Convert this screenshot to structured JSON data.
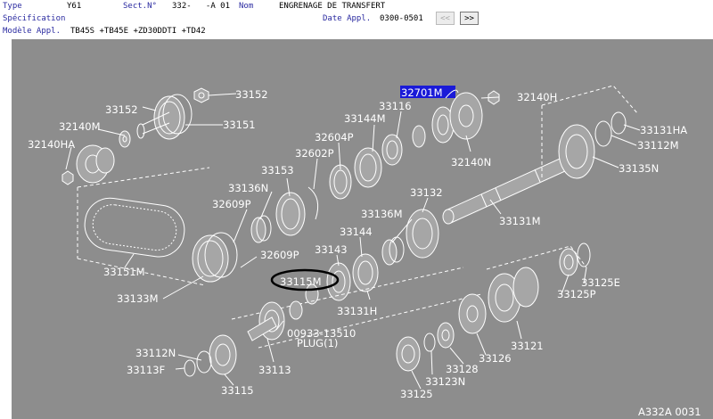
{
  "header": {
    "type_label": "Type",
    "type_value": "Y61",
    "sect_label": "Sect.N°",
    "sect_value": "332-   -A 01",
    "nom_label": "Nom",
    "nom_value": "ENGRENAGE DE TRANSFERT",
    "spec_label": "Spécification",
    "date_label": "Date Appl.",
    "date_value": "0300-0501",
    "model_label": "Modèle Appl.",
    "model_value": "TB45S +TB45E +ZD30DDTI +TD42",
    "prev_label": "<<",
    "next_label": ">>"
  },
  "diagram": {
    "ref_code": "A332A 0031",
    "highlighted_part": "32701M",
    "circled_part": "33115M",
    "plug_note": "PLUG(1)",
    "parts": [
      "33152",
      "33152",
      "33151",
      "32140M",
      "32140HA",
      "33151M",
      "33133M",
      "32701M",
      "32140H",
      "33116",
      "33144M",
      "32604P",
      "32602P",
      "33153",
      "33136N",
      "32609P",
      "32609P",
      "33143",
      "33144",
      "33115M",
      "33131H",
      "33136M",
      "33132",
      "33131M",
      "32140N",
      "33131HA",
      "33112M",
      "33135N",
      "33125E",
      "33125P",
      "33121",
      "33126",
      "33128",
      "33123N",
      "33125",
      "00933-13510",
      "33112N",
      "33113F",
      "33113",
      "33115"
    ]
  }
}
